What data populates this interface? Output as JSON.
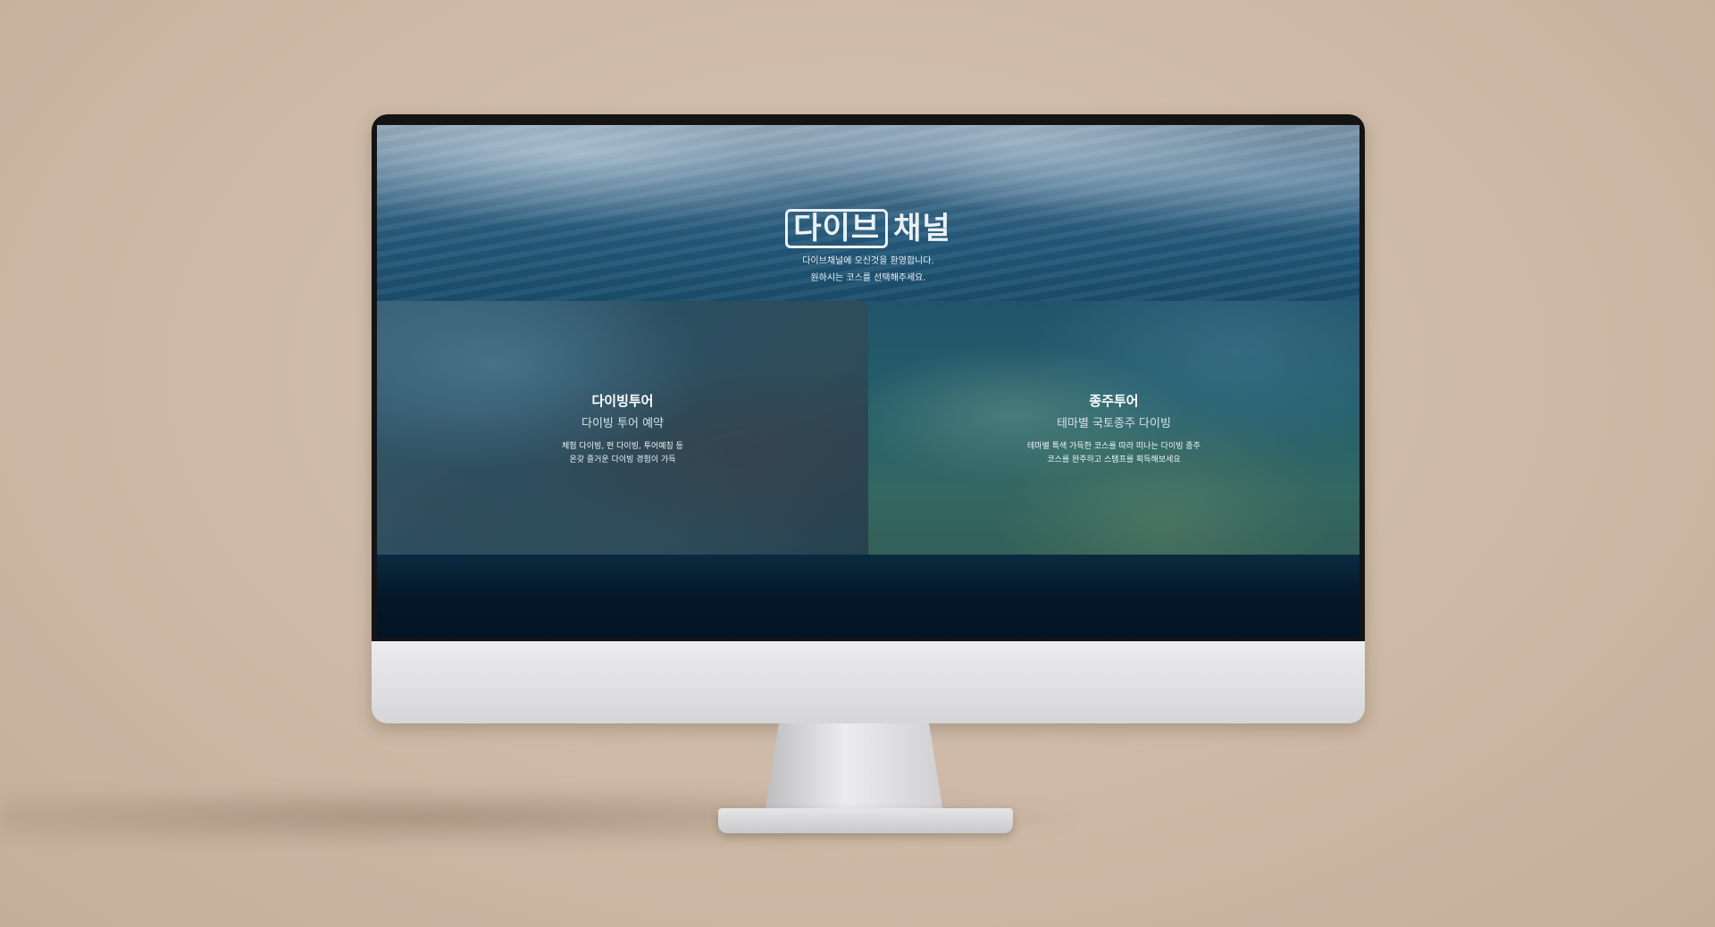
{
  "hero": {
    "logo_box": "다이브",
    "logo_text": "채널",
    "welcome_line1": "다이브채널에 오신것을 환영합니다.",
    "welcome_line2": "원하시는 코스를 선택해주세요."
  },
  "cards": [
    {
      "title": "다이빙투어",
      "subtitle": "다이빙 투어 예약",
      "desc_line1": "체험 다이빙, 펀 다이빙, 투어예칭 등",
      "desc_line2": "온갖 즐거운 다이빙 경험이 가득"
    },
    {
      "title": "종주투어",
      "subtitle": "테마별 국토종주 다이빙",
      "desc_line1": "테마별 특색 가득한 코스를 따라 떠나는 다이빙 종주",
      "desc_line2": "코스를 완주하고 스탬프를 획득해보세요"
    }
  ]
}
